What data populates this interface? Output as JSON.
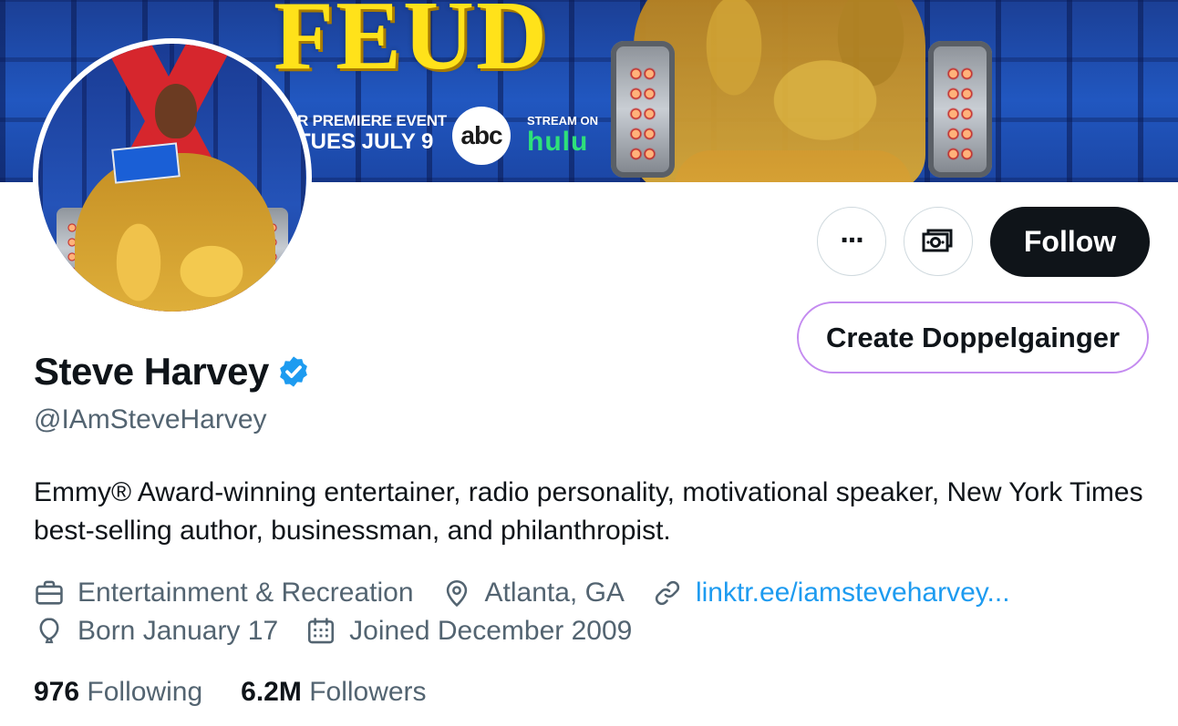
{
  "banner": {
    "feud_text": "FEUD",
    "event_line1": "R PREMIERE EVENT",
    "event_line2": "TUES JULY 9",
    "network_logo": "abc",
    "stream_line1": "STREAM ON",
    "stream_line2": "hulu"
  },
  "actions": {
    "more_icon": "more-horizontal-icon",
    "tip_icon": "money-tip-icon",
    "follow_label": "Follow",
    "doppelganger_label": "Create Doppelgainger"
  },
  "profile": {
    "name": "Steve Harvey",
    "verified": true,
    "handle": "@IAmSteveHarvey",
    "bio": "Emmy® Award-winning entertainer, radio personality, motivational speaker, New York Times best-selling author, businessman, and philanthropist.",
    "category": "Entertainment & Recreation",
    "location": "Atlanta, GA",
    "website": "linktr.ee/iamsteveharvey...",
    "birthday": "Born January 17",
    "joined": "Joined December 2009"
  },
  "stats": {
    "following_count": "976",
    "following_label": "Following",
    "followers_count": "6.2M",
    "followers_label": "Followers"
  },
  "colors": {
    "verified_blue": "#1d9bf0",
    "link_blue": "#1d9bf0",
    "follow_bg": "#0f1419",
    "doppel_border": "#c48bf0",
    "secondary_text": "#536471"
  }
}
